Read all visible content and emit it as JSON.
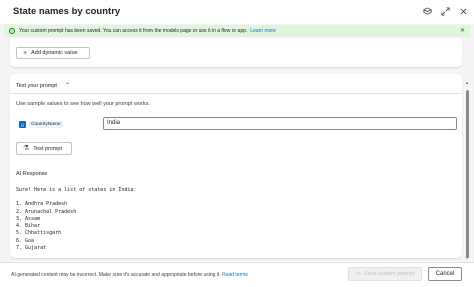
{
  "header": {
    "title": "State names by country",
    "icons": [
      "feedback-icon",
      "expand-icon",
      "close-icon"
    ]
  },
  "banner": {
    "message": "Your custom prompt has been saved. You can access it from the models page or use it in a flow or app.",
    "link": "Learn more"
  },
  "instructions": {
    "add_dynamic_value_label": "Add dynamic value"
  },
  "test_section": {
    "title": "Test your prompt",
    "description": "Use sample values to see how well your prompt works.",
    "variable_name": "CountryName",
    "variable_value": "India",
    "test_button_label": "Test prompt",
    "ai_response_label": "AI Response",
    "response_intro": "Sure! Here is a list of states in India:",
    "response_items": [
      "1. Andhra Pradesh",
      "2. Arunachal Pradesh",
      "3. Assam",
      "4. Bihar",
      "5. Chhattisgarh",
      "6. Goa",
      "7. Gujarat"
    ]
  },
  "footer": {
    "disclaimer": "AI-generated content may be incorrect. Make sure it's accurate and appropriate before using it.",
    "disclaimer_link": "Read terms",
    "save_label": "Save custom prompt",
    "cancel_label": "Cancel"
  },
  "colors": {
    "accent": "#0f6cbd",
    "success_bg": "#dff6dd",
    "success": "#107c10"
  }
}
